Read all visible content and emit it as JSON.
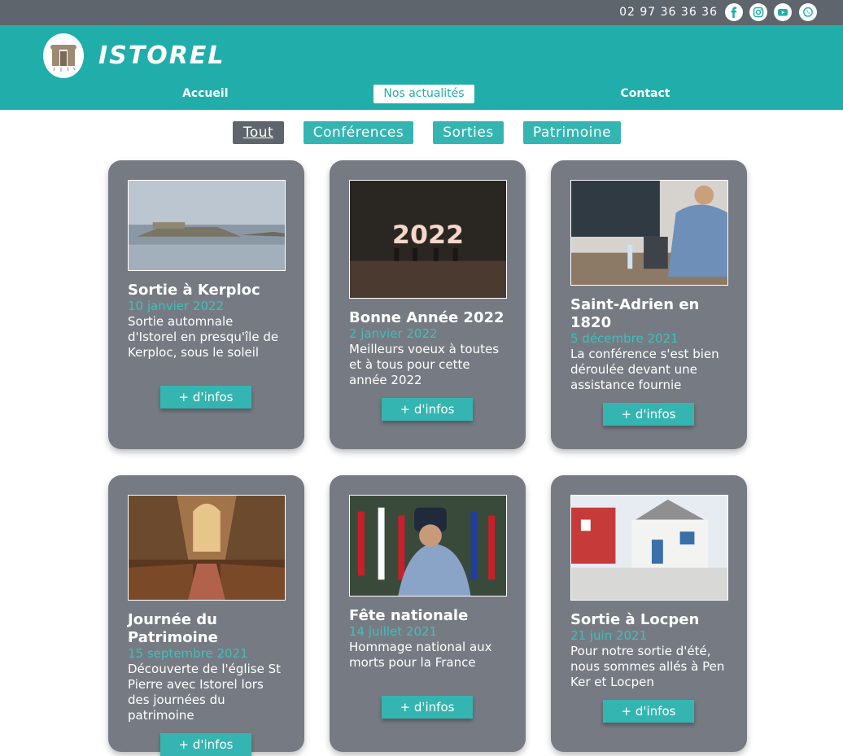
{
  "topbar": {
    "phone": "02 97 36 36 36",
    "social_icons": [
      "facebook-icon",
      "instagram-icon",
      "youtube-icon",
      "whatsapp-icon"
    ]
  },
  "header": {
    "brand": "ISTOREL",
    "nav": [
      "Accueil",
      "Nos actualités",
      "Contact"
    ],
    "active_nav": "Nos actualités"
  },
  "filters": {
    "items": [
      "Tout",
      "Conférences",
      "Sorties",
      "Patrimoine"
    ],
    "active": "Tout"
  },
  "cards": [
    {
      "title": "Sortie à Kerploc",
      "date": "10 janvier 2022",
      "description": "Sortie automnale d'Istorel en presqu'île de Kerploc, sous le soleil",
      "button": "+ d'infos"
    },
    {
      "title": "Bonne Année 2022",
      "date": "2 janvier 2022",
      "description": "Meilleurs voeux à toutes et à tous pour cette année 2022",
      "button": "+ d'infos",
      "image_text": "2022"
    },
    {
      "title": "Saint-Adrien en 1820",
      "date": "5 décembre 2021",
      "description": "La conférence s'est bien déroulée devant une assistance fournie",
      "button": "+ d'infos"
    },
    {
      "title": "Journée du Patrimoine",
      "date": "15 septembre 2021",
      "description": "Découverte de l'église St Pierre avec Istorel lors des journées du patrimoine",
      "button": "+ d'infos"
    },
    {
      "title": "Fête nationale",
      "date": "14 juillet 2021",
      "description": "Hommage national aux morts pour la France",
      "button": "+ d'infos"
    },
    {
      "title": "Sortie à Locpen",
      "date": "21 juin 2021",
      "description": "Pour notre sortie d'été, nous sommes allés à Pen Ker et Locpen",
      "button": "+ d'infos"
    }
  ],
  "colors": {
    "topbar": "#5f656c",
    "header": "#21aeab",
    "accent": "#35b5b1",
    "card": "#767b83",
    "date": "#3cc0bc"
  }
}
